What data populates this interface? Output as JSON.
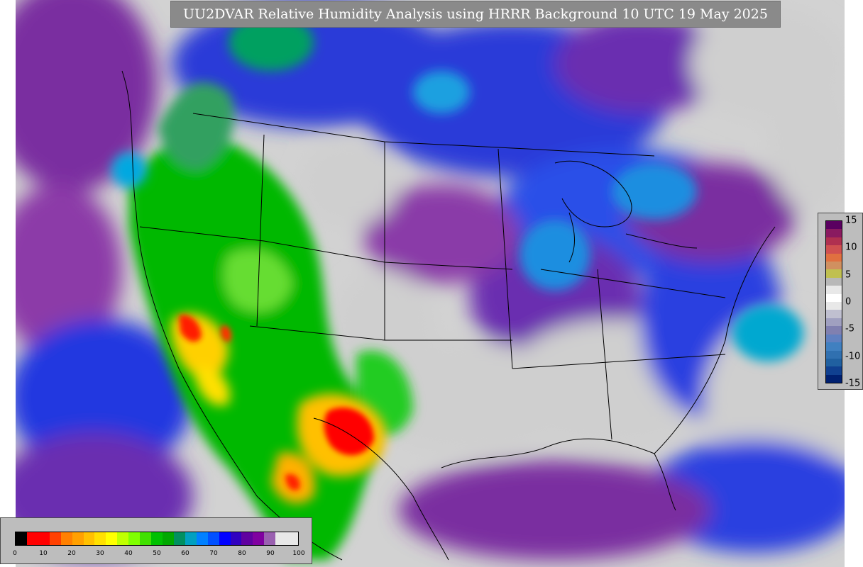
{
  "title": "UU2DVAR Relative Humidity Analysis using HRRR Background 10 UTC 19 May 2025",
  "rh_colorbar": {
    "ticks": [
      "0",
      "10",
      "20",
      "30",
      "40",
      "50",
      "60",
      "70",
      "80",
      "90",
      "100"
    ],
    "colors": [
      "#000000",
      "#ff0000",
      "#ff0000",
      "#ff4000",
      "#ff8000",
      "#ffa000",
      "#ffc000",
      "#ffe000",
      "#ffff00",
      "#c0ff00",
      "#80ff00",
      "#40e000",
      "#00c000",
      "#00a800",
      "#009060",
      "#00a0c0",
      "#0080ff",
      "#0050ff",
      "#0000ff",
      "#3000c0",
      "#6000a0",
      "#8000a0",
      "#9a60b0",
      "#e8e8e8",
      "#e8e8e8"
    ]
  },
  "increment_colorbar": {
    "ticks": [
      "15",
      "10",
      "5",
      "0",
      "-5",
      "-10",
      "-15"
    ],
    "colors": [
      "#5a0060",
      "#8a1a60",
      "#b03050",
      "#d05050",
      "#e07040",
      "#d09060",
      "#c0c050",
      "#b8b8b8",
      "#e8e8e8",
      "#ffffff",
      "#e8e8e8",
      "#c0c0d0",
      "#a0a0c0",
      "#8080b0",
      "#6080c0",
      "#4080c0",
      "#3070b0",
      "#2060a0",
      "#104090",
      "#002070"
    ]
  },
  "colors": {
    "background": "#cfcfcf",
    "banner": "#8a8a8a",
    "panel": "#bdbdbd"
  }
}
